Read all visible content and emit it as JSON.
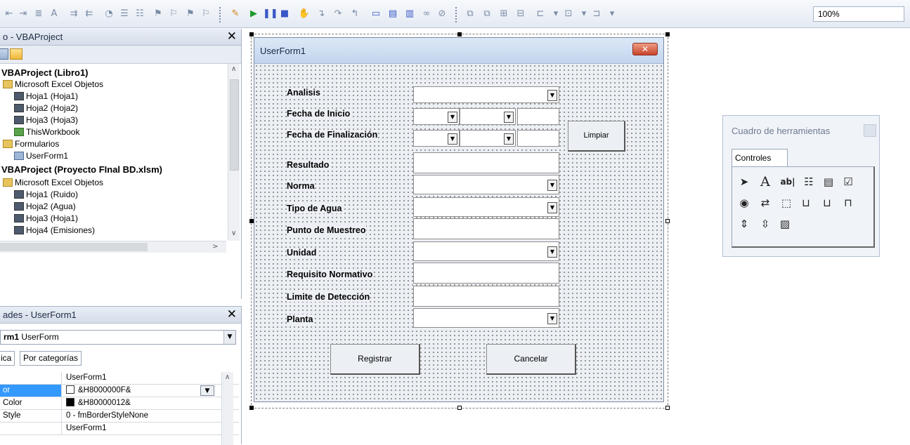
{
  "toolbar": {
    "zoom": "100%"
  },
  "project_explorer": {
    "title": "o - VBAProject",
    "close": "✕",
    "tree": [
      {
        "label": "VBAProject (Libro1)",
        "kind": "project"
      },
      {
        "label": "Microsoft Excel Objetos",
        "kind": "folder"
      },
      {
        "label": "Hoja1 (Hoja1)",
        "kind": "sheet"
      },
      {
        "label": "Hoja2 (Hoja2)",
        "kind": "sheet"
      },
      {
        "label": "Hoja3 (Hoja3)",
        "kind": "sheet"
      },
      {
        "label": "ThisWorkbook",
        "kind": "book"
      },
      {
        "label": "Formularios",
        "kind": "folder"
      },
      {
        "label": "UserForm1",
        "kind": "form"
      },
      {
        "label": "VBAProject (Proyecto FInal BD.xlsm)",
        "kind": "project"
      },
      {
        "label": "Microsoft Excel Objetos",
        "kind": "folder"
      },
      {
        "label": "Hoja1 (Ruido)",
        "kind": "sheet"
      },
      {
        "label": "Hoja2 (Agua)",
        "kind": "sheet"
      },
      {
        "label": "Hoja3 (Hoja1)",
        "kind": "sheet"
      },
      {
        "label": "Hoja4 (Emisiones)",
        "kind": "sheet"
      }
    ]
  },
  "properties": {
    "title": "ades - UserForm1",
    "close": "✕",
    "object_name": "rm1",
    "object_type": "UserForm",
    "tabs": [
      "ica",
      "Por categorías"
    ],
    "rows": [
      {
        "name": "",
        "value": "UserForm1"
      },
      {
        "name": "or",
        "value": "&H8000000F&",
        "swatch": "#ffffff",
        "has_dropdown": true,
        "selected": true
      },
      {
        "name": "Color",
        "value": "&H80000012&",
        "swatch": "#000000"
      },
      {
        "name": "Style",
        "value": "0 - fmBorderStyleNone"
      },
      {
        "name": "",
        "value": "UserForm1"
      }
    ]
  },
  "userform": {
    "title": "UserForm1",
    "close": "✕",
    "labels": {
      "analisis": "Analisis",
      "fecha_inicio": "Fecha de Inicio",
      "fecha_fin": "Fecha de Finalización",
      "resultado": "Resultado",
      "norma": "Norma",
      "tipo_agua": "Tipo de Agua",
      "punto_muestreo": "Punto de Muestreo",
      "unidad": "Unidad",
      "requisito": "Requisito Normativo",
      "limite": "Limite de Detección",
      "planta": "Planta"
    },
    "buttons": {
      "limpiar": "Limpiar",
      "registrar": "Registrar",
      "cancelar": "Cancelar"
    }
  },
  "toolbox": {
    "title": "Cuadro de herramientas",
    "tab": "Controles"
  },
  "colors": {
    "form_bg": "#eceff4",
    "titlebar": "#c2d5ee",
    "close_red": "#c8432b"
  }
}
